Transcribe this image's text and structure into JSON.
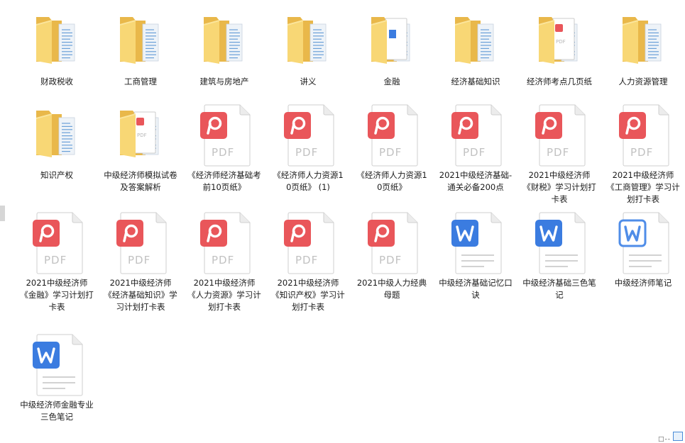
{
  "items": [
    {
      "label": "财政税收",
      "kind": "folder"
    },
    {
      "label": "工商管理",
      "kind": "folder"
    },
    {
      "label": "建筑与房地产",
      "kind": "folder"
    },
    {
      "label": "讲义",
      "kind": "folder"
    },
    {
      "label": "金融",
      "kind": "folder-doc"
    },
    {
      "label": "经济基础知识",
      "kind": "folder"
    },
    {
      "label": "经济师考点几页纸",
      "kind": "folder-pdf"
    },
    {
      "label": "人力资源管理",
      "kind": "folder"
    },
    {
      "label": "知识产权",
      "kind": "folder"
    },
    {
      "label": "中级经济师模拟试卷及答案解析",
      "kind": "folder-pdf"
    },
    {
      "label": "《经济师经济基础考前10页纸》",
      "kind": "pdf"
    },
    {
      "label": "《经济师人力资源10页纸》 (1)",
      "kind": "pdf"
    },
    {
      "label": "《经济师人力资源10页纸》",
      "kind": "pdf"
    },
    {
      "label": "2021中级经济基础-通关必备200点",
      "kind": "pdf"
    },
    {
      "label": "2021中级经济师《财税》学习计划打卡表",
      "kind": "pdf"
    },
    {
      "label": "2021中级经济师《工商管理》学习计划打卡表",
      "kind": "pdf"
    },
    {
      "label": "2021中级经济师《金融》学习计划打卡表",
      "kind": "pdf"
    },
    {
      "label": "2021中级经济师《经济基础知识》学习计划打卡表",
      "kind": "pdf"
    },
    {
      "label": "2021中级经济师《人力资源》学习计划打卡表",
      "kind": "pdf"
    },
    {
      "label": "2021中级经济师《知识产权》学习计划打卡表",
      "kind": "pdf"
    },
    {
      "label": "2021中级人力经典母题",
      "kind": "pdf"
    },
    {
      "label": "中级经济基础记忆口诀",
      "kind": "word"
    },
    {
      "label": "中级经济基础三色笔记",
      "kind": "word"
    },
    {
      "label": "中级经济师笔记",
      "kind": "word-outline"
    },
    {
      "label": "中级经济师金融专业三色笔记",
      "kind": "word"
    }
  ],
  "icons": {
    "folder": "folder-icon",
    "folder-doc": "folder-with-document-icon",
    "folder-pdf": "folder-with-pdf-icon",
    "pdf": "pdf-file-icon",
    "word": "word-file-icon",
    "word-outline": "word-file-icon"
  },
  "colors": {
    "folder_back": "#e9b84a",
    "folder_front": "#f8d775",
    "pdf_red": "#e9565a",
    "word_blue": "#3b7ce0",
    "word_outline": "#4f8de8",
    "page_gray": "#e0e0e0"
  },
  "status": {
    "dots": "□--"
  }
}
